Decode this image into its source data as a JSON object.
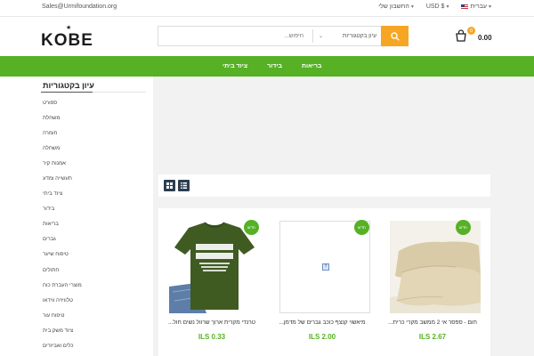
{
  "topbar": {
    "email": "Sales@Urmifoundation.org",
    "account": "החשבון שלי",
    "currency": "USD $",
    "language": "עברית"
  },
  "header": {
    "logo_text": "KOBE",
    "search_placeholder": "חיפוש...",
    "search_category": "עיון בקטגוריות",
    "cart_count": "0",
    "cart_total": "0.00"
  },
  "nav": {
    "items": [
      "בריאות",
      "בידור",
      "ציוד ביתי"
    ]
  },
  "sidebar": {
    "title": "עיון בקטגוריות",
    "items": [
      "ספורט",
      "משחלת",
      "חומרה",
      "משחלה",
      "אמנות קיר",
      "תעשייה ומדע",
      "ציוד ביתי",
      "בידור",
      "בריאות",
      "גברים",
      "טיפוח שיער",
      "חתולים",
      "מוצרי העברת כוח",
      "טלוויזיה ווידאו",
      "טיפוח עור",
      "ציוד משק בית",
      "כלים ואביזרים"
    ]
  },
  "products": [
    {
      "badge": "חדש",
      "title": "טרנדי מקרית ארוך שרוול נשים חול...",
      "price": "ILS 0.33"
    },
    {
      "badge": "חדש",
      "title": "מיאשוי קנצף כוכב גברים של מדמן...",
      "price": "ILS 2.00"
    },
    {
      "badge": "חדש",
      "title": "חום - ספסר אי 2 ממשב מקרי כרית...",
      "price": "ILS 2.67"
    }
  ],
  "colors": {
    "brand_green": "#56b125",
    "accent_orange": "#f6a623",
    "dark_button": "#2d3e50"
  }
}
